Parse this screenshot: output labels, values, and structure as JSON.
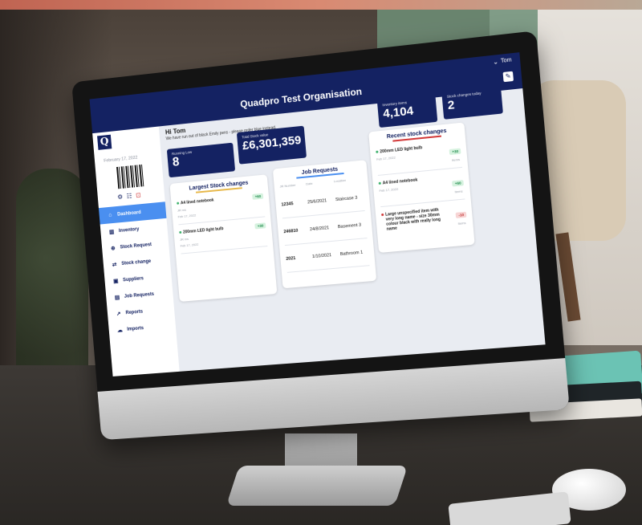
{
  "header": {
    "org_title": "Quadpro Test Organisation",
    "user_name": "Tom"
  },
  "logo": {
    "letter": "Q"
  },
  "sidebar": {
    "date": "February 17, 2022",
    "nav": [
      {
        "label": "Dashboard",
        "icon": "home-icon",
        "active": true
      },
      {
        "label": "Inventory",
        "icon": "chart-icon"
      },
      {
        "label": "Stock Request",
        "icon": "plus-icon"
      },
      {
        "label": "Stock change",
        "icon": "swap-icon"
      },
      {
        "label": "Suppliers",
        "icon": "suppliers-icon"
      },
      {
        "label": "Job Requests",
        "icon": "briefcase-icon"
      },
      {
        "label": "Reports",
        "icon": "trend-icon"
      },
      {
        "label": "Imports",
        "icon": "cloud-upload-icon"
      }
    ]
  },
  "greeting": {
    "title": "Hi Tom",
    "notice": "We have run out of black Emily pens - please order blue instead."
  },
  "stats": {
    "running_low": {
      "label": "Running Low",
      "value": "8"
    },
    "total_stock": {
      "label": "Total Stock value",
      "value": "£6,301,359"
    },
    "inventory_items": {
      "label": "Inventory items",
      "value": "4,104"
    },
    "stock_changes_today": {
      "label": "Stock changes today",
      "value": "2"
    }
  },
  "largest_stock_changes": {
    "title": "Largest Stock changes",
    "items": [
      {
        "name": "A4 lined notebook",
        "sub": "JR ms",
        "date": "Feb 17, 2022",
        "badge": "+60"
      },
      {
        "name": "200mm LED light bulb",
        "sub": "JR ms",
        "date": "Feb 17, 2022",
        "badge": "+30"
      }
    ]
  },
  "job_requests": {
    "title": "Job Requests",
    "columns": [
      "JR Number",
      "Date",
      "Location"
    ],
    "rows": [
      {
        "number": "12345",
        "date": "25/6/2021",
        "location": "Staircase 3"
      },
      {
        "number": "246810",
        "date": "24/8/2021",
        "location": "Basement 3"
      },
      {
        "number": "2021",
        "date": "1/10/2021",
        "location": "Bathroom 1"
      }
    ]
  },
  "recent_stock_changes": {
    "title": "Recent stock changes",
    "items": [
      {
        "name": "200mm LED light bulb",
        "date": "Feb 17, 2022",
        "badge": "+30",
        "badge_sub": "items",
        "negative": false
      },
      {
        "name": "A4 lined notebook",
        "date": "Feb 17, 2022",
        "badge": "+60",
        "badge_sub": "items",
        "negative": false
      },
      {
        "name": "Large unspecified item with very long name - size 30mm colour black with really long name",
        "date": "",
        "badge": "-10",
        "badge_sub": "items",
        "negative": true
      }
    ]
  }
}
